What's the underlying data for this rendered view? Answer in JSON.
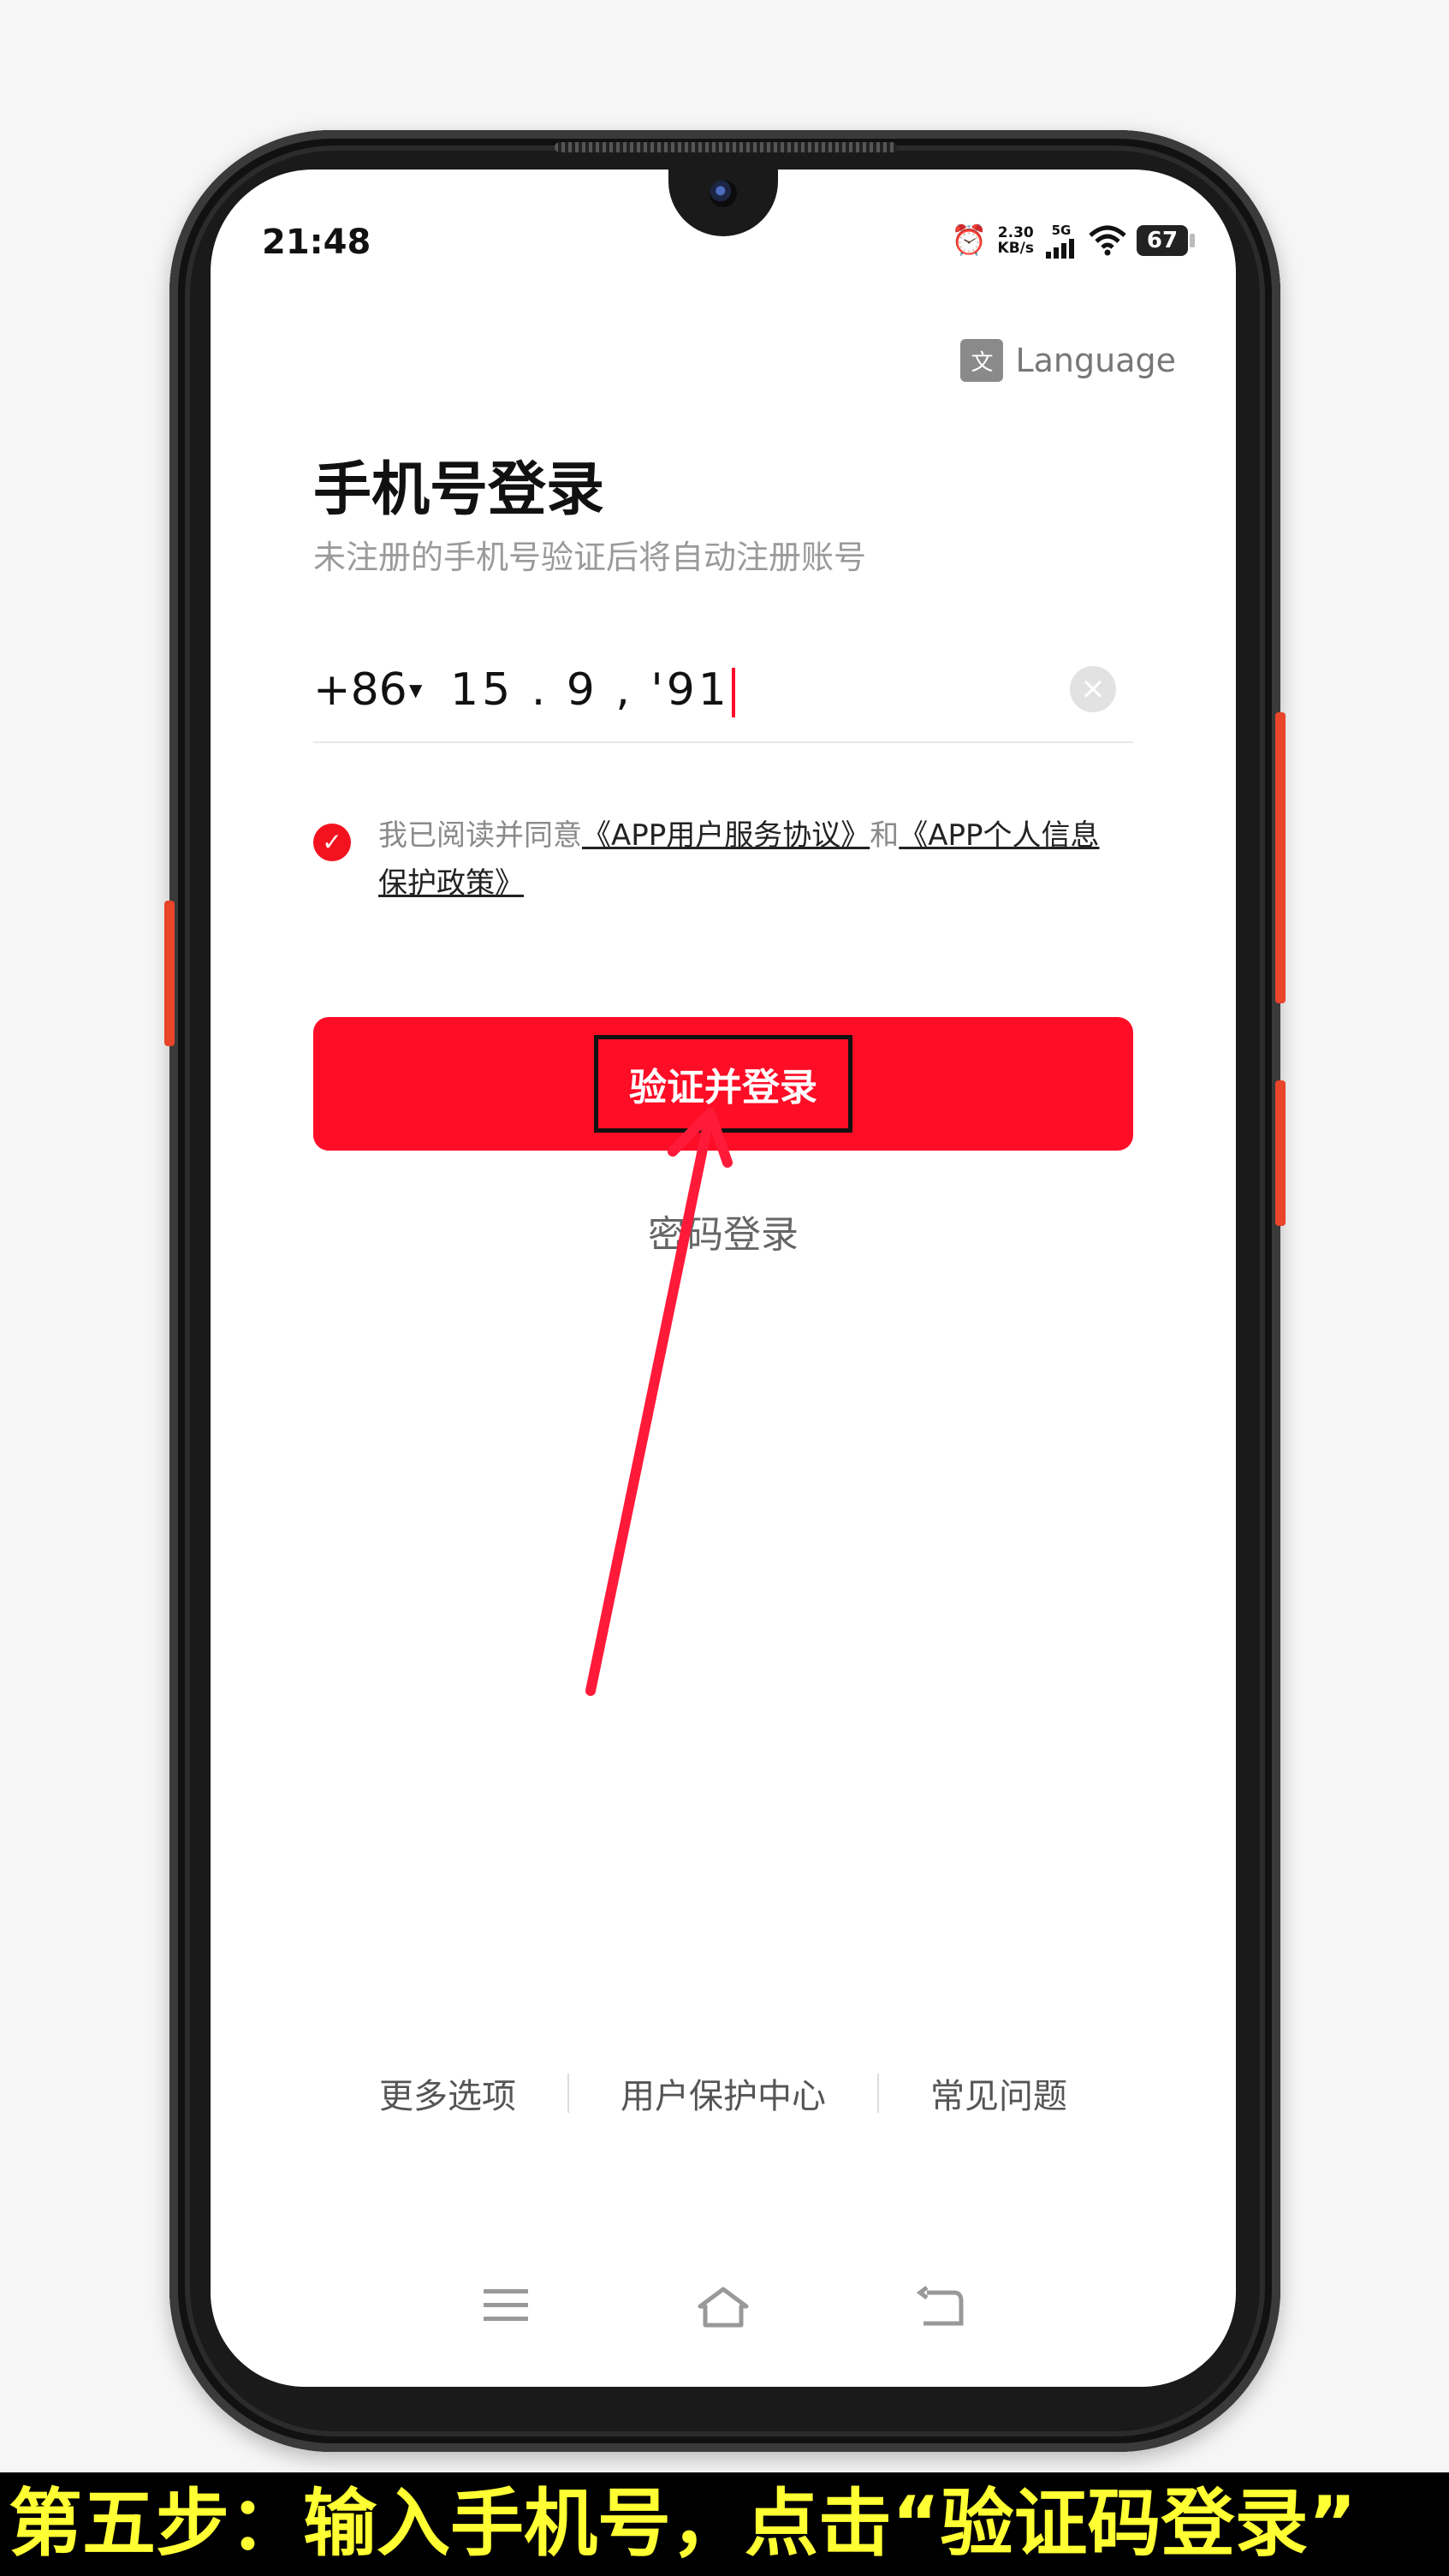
{
  "status_bar": {
    "time": "21:48",
    "net_speed_value": "2.30",
    "net_speed_unit": "KB/s",
    "network": "5G",
    "battery": "67"
  },
  "language_button": {
    "icon": "translate-icon",
    "label": "Language"
  },
  "header": {
    "title": "手机号登录",
    "subtitle": "未注册的手机号验证后将自动注册账号"
  },
  "phone_input": {
    "country_code": "+86",
    "value": "15 .  9  ,  '91"
  },
  "agreement": {
    "checked": true,
    "prefix": "我已阅读并同意",
    "link1": "《APP用户服务协议》",
    "middle": "和",
    "link2_part1": "《APP个人信息",
    "link2_part2": "保护政策》"
  },
  "primary_button": {
    "label": "验证并登录"
  },
  "alt_login": {
    "label": "密码登录"
  },
  "footer_links": [
    "更多选项",
    "用户保护中心",
    "常见问题"
  ],
  "nav_bar": {
    "icons": [
      "menu-icon",
      "home-icon",
      "back-icon"
    ]
  },
  "caption": "第五步：输入手机号，点击“验证码登录”",
  "colors": {
    "accent": "#fe0d26",
    "caption_text": "#ffff33",
    "arrow": "#ff1a3a"
  }
}
